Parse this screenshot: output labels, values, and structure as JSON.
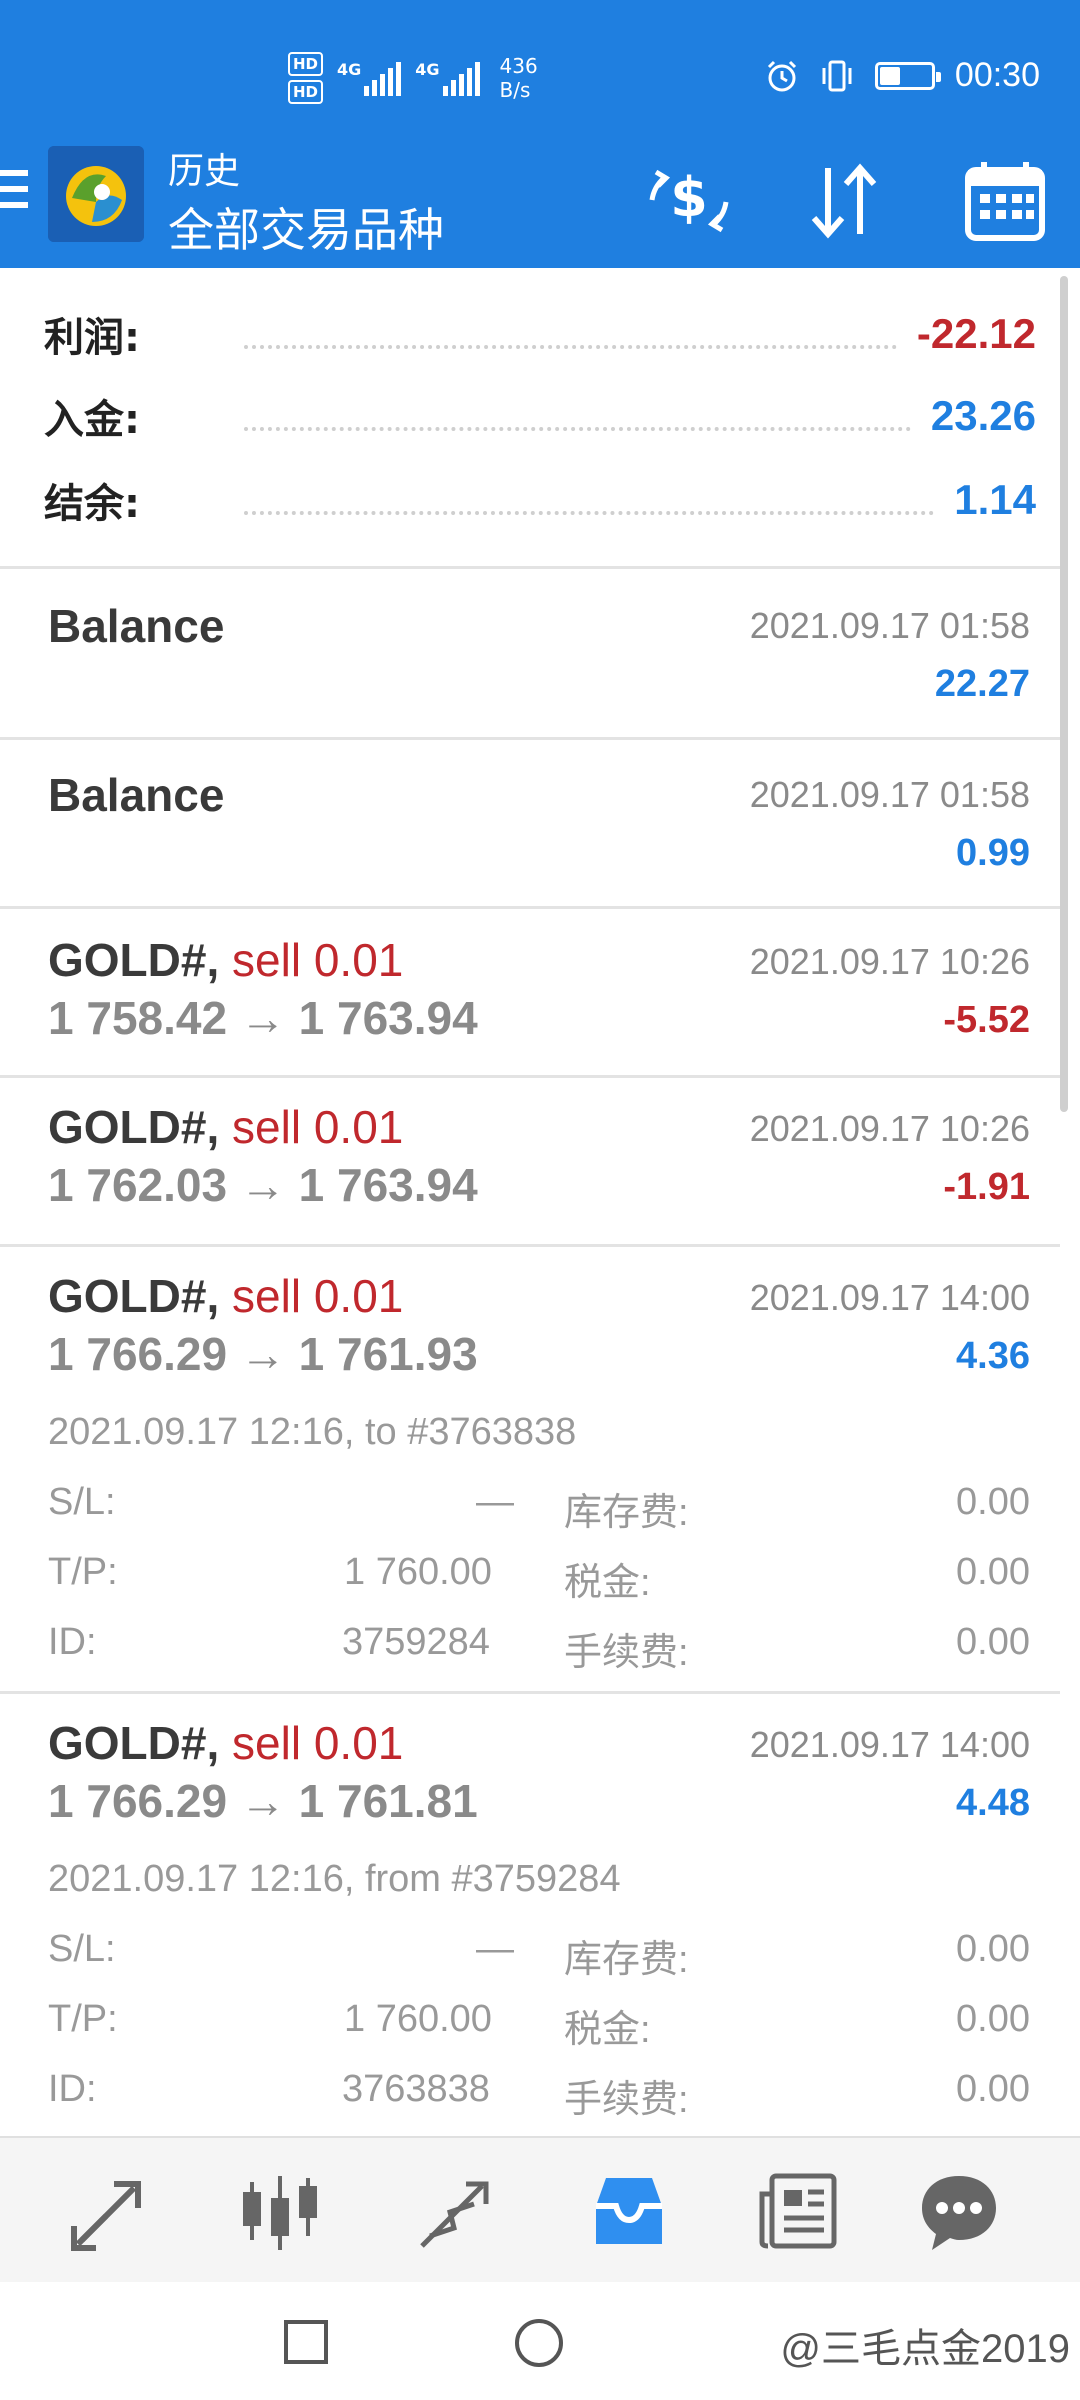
{
  "status_bar": {
    "hd1": "HD",
    "hd2": "HD",
    "net1": "4G",
    "net2": "4G",
    "speed_value": "436",
    "speed_unit": "B/s",
    "time": "00:30"
  },
  "header": {
    "title": "历史",
    "subtitle": "全部交易品种"
  },
  "summary": [
    {
      "label": "利润:",
      "value": "-22.12",
      "color": "#c0282d"
    },
    {
      "label": "入金:",
      "value": "23.26",
      "color": "#1f7fe0"
    },
    {
      "label": "结余:",
      "value": "1.14",
      "color": "#1f7fe0"
    }
  ],
  "items": [
    {
      "symbol": "Balance",
      "datetime": "2021.09.17 01:58",
      "profit": "22.27"
    },
    {
      "symbol": "Balance",
      "datetime": "2021.09.17 01:58",
      "profit": "0.99"
    },
    {
      "symbol": "GOLD#,",
      "trade": "sell 0.01",
      "prices": "1 758.42 → 1 763.94",
      "datetime": "2021.09.17 10:26",
      "profit": "-5.52"
    },
    {
      "symbol": "GOLD#,",
      "trade": "sell 0.01",
      "prices": "1 762.03 → 1 763.94",
      "datetime": "2021.09.17 10:26",
      "profit": "-1.91"
    },
    {
      "symbol": "GOLD#,",
      "trade": "sell 0.01",
      "prices": "1 766.29 → 1 761.93",
      "datetime": "2021.09.17 14:00",
      "profit": "4.36",
      "detail": "2021.09.17 12:16, to #3763838",
      "sl_label": "S/L:",
      "sl": "—",
      "tp_label": "T/P:",
      "tp": "1 760.00",
      "id_label": "ID:",
      "id": "3759284",
      "swap_label": "库存费:",
      "swap": "0.00",
      "tax_label": "税金:",
      "tax": "0.00",
      "fee_label": "手续费:",
      "fee": "0.00"
    },
    {
      "symbol": "GOLD#,",
      "trade": "sell 0.01",
      "prices": "1 766.29 → 1 761.81",
      "datetime": "2021.09.17 14:00",
      "profit": "4.48",
      "detail": "2021.09.17 12:16, from #3759284",
      "sl_label": "S/L:",
      "sl": "—",
      "tp_label": "T/P:",
      "tp": "1 760.00",
      "id_label": "ID:",
      "id": "3763838",
      "swap_label": "库存费:",
      "swap": "0.00",
      "tax_label": "税金:",
      "tax": "0.00",
      "fee_label": "手续费:",
      "fee": "0.00"
    }
  ],
  "bottom_nav": [
    "quotes-icon",
    "chart-icon",
    "trade-icon",
    "history-icon",
    "news-icon",
    "chat-icon"
  ],
  "watermark": "@三毛点金2019",
  "colors": {
    "accent": "#1f7fe0",
    "negative": "#c0282d",
    "active_tab": "#2f8ff0"
  }
}
